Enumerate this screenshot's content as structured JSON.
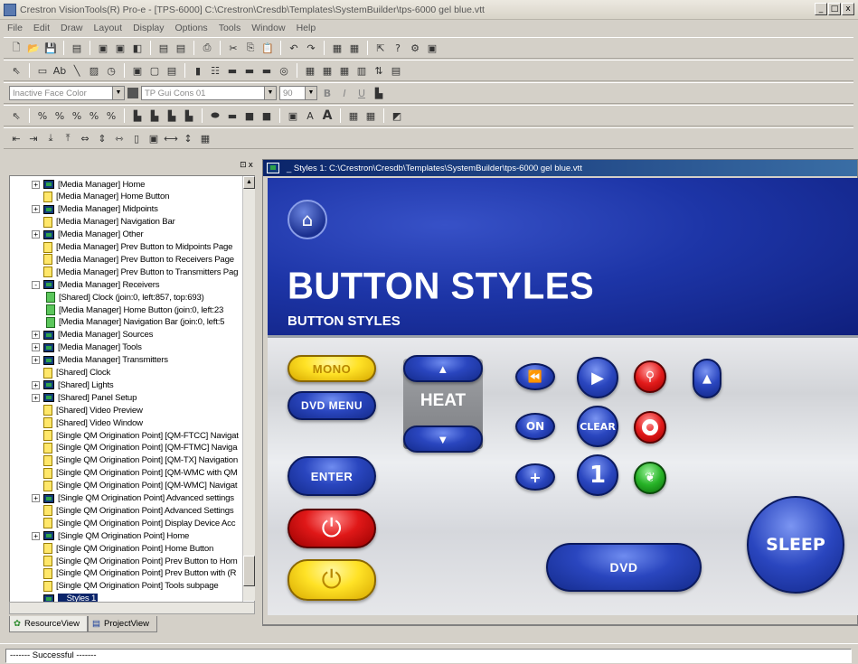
{
  "window": {
    "title": "Crestron VisionTools(R) Pro-e - [TPS-6000] C:\\Crestron\\Cresdb\\Templates\\SystemBuilder\\tps-6000 gel blue.vtt",
    "controls": [
      "_",
      "□",
      "x"
    ]
  },
  "menu": [
    "File",
    "Edit",
    "Draw",
    "Layout",
    "Display",
    "Options",
    "Tools",
    "Window",
    "Help"
  ],
  "format_toolbar": {
    "face_color": "Inactive Face Color",
    "font": "TP Gui Cons 01",
    "size": "90",
    "bold": "B",
    "italic": "I",
    "underline": "U"
  },
  "left_panel": {
    "header_controls": [
      "⊡",
      "x"
    ],
    "tree_items": [
      {
        "expander": "+",
        "icon": "screen",
        "label": "[Media Manager] Home"
      },
      {
        "expander": "",
        "icon": "page",
        "label": "[Media Manager] Home Button"
      },
      {
        "expander": "+",
        "icon": "screen",
        "label": "[Media Manager] Midpoints"
      },
      {
        "expander": "",
        "icon": "page",
        "label": "[Media Manager] Navigation Bar"
      },
      {
        "expander": "+",
        "icon": "screen",
        "label": "[Media Manager] Other"
      },
      {
        "expander": "",
        "icon": "page",
        "label": "[Media Manager] Prev Button to Midpoints Page"
      },
      {
        "expander": "",
        "icon": "page",
        "label": "[Media Manager] Prev Button to Receivers Page"
      },
      {
        "expander": "",
        "icon": "page",
        "label": "[Media Manager] Prev Button to Transmitters Pag"
      },
      {
        "expander": "-",
        "icon": "screen",
        "label": "[Media Manager] Receivers"
      },
      {
        "expander": "",
        "icon": "green",
        "label": "[Shared] Clock (join:0, left:857, top:693)",
        "indent": 1
      },
      {
        "expander": "",
        "icon": "green",
        "label": "[Media Manager] Home Button (join:0, left:23",
        "indent": 1
      },
      {
        "expander": "",
        "icon": "green",
        "label": "[Media Manager] Navigation Bar (join:0, left:5",
        "indent": 1
      },
      {
        "expander": "+",
        "icon": "screen",
        "label": "[Media Manager] Sources"
      },
      {
        "expander": "+",
        "icon": "screen",
        "label": "[Media Manager] Tools"
      },
      {
        "expander": "+",
        "icon": "screen",
        "label": "[Media Manager] Transmitters"
      },
      {
        "expander": "",
        "icon": "page",
        "label": "[Shared] Clock"
      },
      {
        "expander": "+",
        "icon": "screen",
        "label": "[Shared] Lights"
      },
      {
        "expander": "+",
        "icon": "screen",
        "label": "[Shared] Panel Setup"
      },
      {
        "expander": "",
        "icon": "page",
        "label": "[Shared] Video Preview"
      },
      {
        "expander": "",
        "icon": "page",
        "label": "[Shared] Video Window"
      },
      {
        "expander": "",
        "icon": "page",
        "label": "[Single QM Origination Point] [QM-FTCC] Navigat"
      },
      {
        "expander": "",
        "icon": "page",
        "label": "[Single QM Origination Point] [QM-FTMC] Naviga"
      },
      {
        "expander": "",
        "icon": "page",
        "label": "[Single QM Origination Point] [QM-TX] Navigation"
      },
      {
        "expander": "",
        "icon": "page",
        "label": "[Single QM Origination Point] [QM-WMC with QM"
      },
      {
        "expander": "",
        "icon": "page",
        "label": "[Single QM Origination Point] [QM-WMC] Navigat"
      },
      {
        "expander": "+",
        "icon": "screen",
        "label": "[Single QM Origination Point] Advanced settings"
      },
      {
        "expander": "",
        "icon": "page",
        "label": "[Single QM Origination Point] Advanced Settings"
      },
      {
        "expander": "",
        "icon": "page",
        "label": "[Single QM Origination Point] Display Device Acc"
      },
      {
        "expander": "+",
        "icon": "screen",
        "label": "[Single QM Origination Point] Home"
      },
      {
        "expander": "",
        "icon": "page",
        "label": "[Single QM Origination Point] Home Button"
      },
      {
        "expander": "",
        "icon": "page",
        "label": "[Single QM Origination Point] Prev Button to Hom"
      },
      {
        "expander": "",
        "icon": "page",
        "label": "[Single QM Origination Point] Prev Button with (R"
      },
      {
        "expander": "",
        "icon": "page",
        "label": "[Single QM Origination Point] Tools subpage"
      },
      {
        "expander": "",
        "icon": "screen",
        "label": "_ Styles 1",
        "selected": true
      }
    ],
    "tabs": [
      "ResourceView",
      "ProjectView"
    ]
  },
  "design_window": {
    "title": "_ Styles 1: C:\\Crestron\\Cresdb\\Templates\\SystemBuilder\\tps-6000 gel blue.vtt",
    "header_title": "BUTTON STYLES",
    "header_subtitle": "BUTTON STYLES",
    "buttons": {
      "mono": "MONO",
      "dvd_menu": "DVD MENU",
      "enter": "ENTER",
      "heat": "HEAT",
      "on": "ON",
      "clear": "CLEAR",
      "plus": "+",
      "one": "1",
      "dvd": "DVD",
      "sleep": "SLEEP"
    }
  },
  "status": {
    "text": "------- Successful -------"
  },
  "colors": {
    "accent_blue": "#1d35a7",
    "selection": "#0a246a"
  }
}
